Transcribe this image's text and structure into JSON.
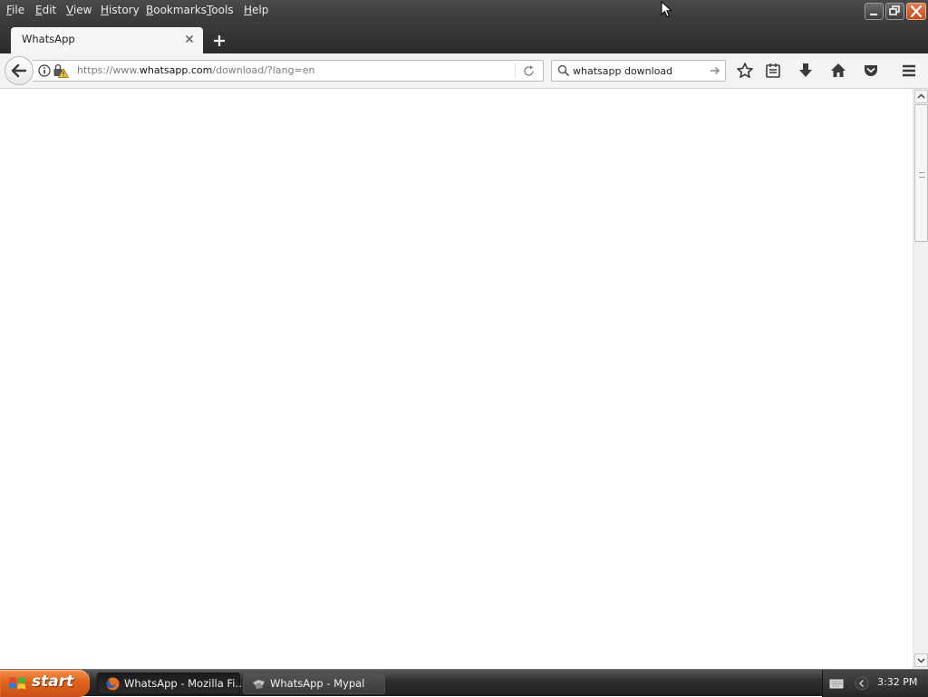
{
  "menubar": {
    "items": [
      {
        "label": "File"
      },
      {
        "label": "Edit"
      },
      {
        "label": "View"
      },
      {
        "label": "History"
      },
      {
        "label": "Bookmarks"
      },
      {
        "label": "Tools"
      },
      {
        "label": "Help"
      }
    ]
  },
  "tabs": [
    {
      "title": "WhatsApp",
      "active": true
    }
  ],
  "navbar": {
    "url_prefix": "https://www.",
    "url_host": "whatsapp.com",
    "url_path": "/download/?lang=en",
    "search_value": "whatsapp download"
  },
  "taskbar": {
    "start_label": "start",
    "tasks": [
      {
        "label": "WhatsApp - Mozilla Fi…",
        "icon": "firefox-icon",
        "active": true
      },
      {
        "label": "WhatsApp - Mypal",
        "icon": "mypal-icon",
        "active": false
      }
    ],
    "clock": "3:32 PM"
  },
  "colors": {
    "chrome_dark": "#3b3b3b",
    "start_orange": "#e0621a",
    "close_red": "#c44a1c",
    "page_bg": "#ffffff"
  }
}
